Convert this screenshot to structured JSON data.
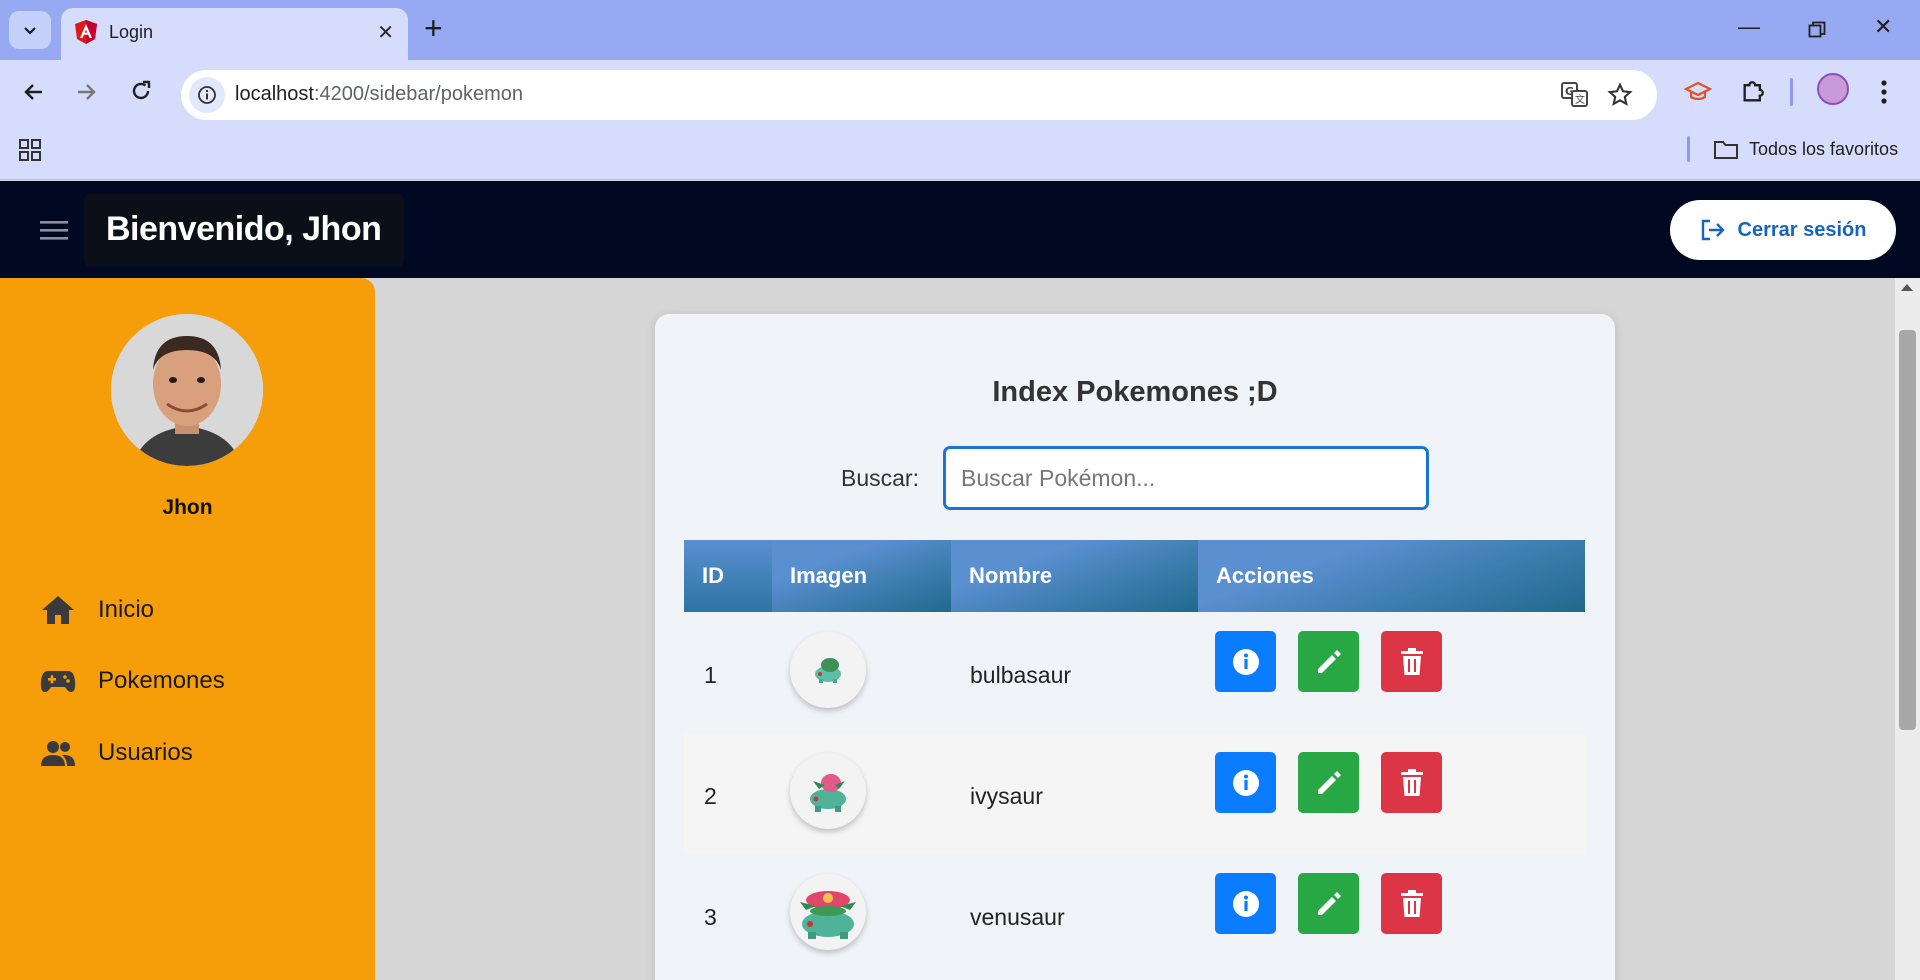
{
  "browser": {
    "tab_title": "Login",
    "url_host": "localhost",
    "url_path": ":4200/sidebar/pokemon",
    "bookmarks_folder": "Todos los favoritos"
  },
  "header": {
    "welcome": "Bienvenido, Jhon",
    "logout_label": "Cerrar sesión"
  },
  "sidebar": {
    "user_name": "Jhon",
    "items": [
      {
        "label": "Inicio",
        "icon": "home-icon"
      },
      {
        "label": "Pokemones",
        "icon": "gamepad-icon"
      },
      {
        "label": "Usuarios",
        "icon": "users-icon"
      }
    ]
  },
  "main": {
    "title": "Index Pokemones ;D",
    "search_label": "Buscar:",
    "search_placeholder": "Buscar Pokémon...",
    "columns": [
      "ID",
      "Imagen",
      "Nombre",
      "Acciones"
    ],
    "rows": [
      {
        "id": "1",
        "name": "bulbasaur"
      },
      {
        "id": "2",
        "name": "ivysaur"
      },
      {
        "id": "3",
        "name": "venusaur"
      }
    ]
  },
  "colors": {
    "header_bg": "#010822",
    "sidebar_bg": "#f59e09",
    "info_btn": "#0a7cff",
    "edit_btn": "#28a745",
    "delete_btn": "#dc3545",
    "logout_text": "#1565c0"
  }
}
